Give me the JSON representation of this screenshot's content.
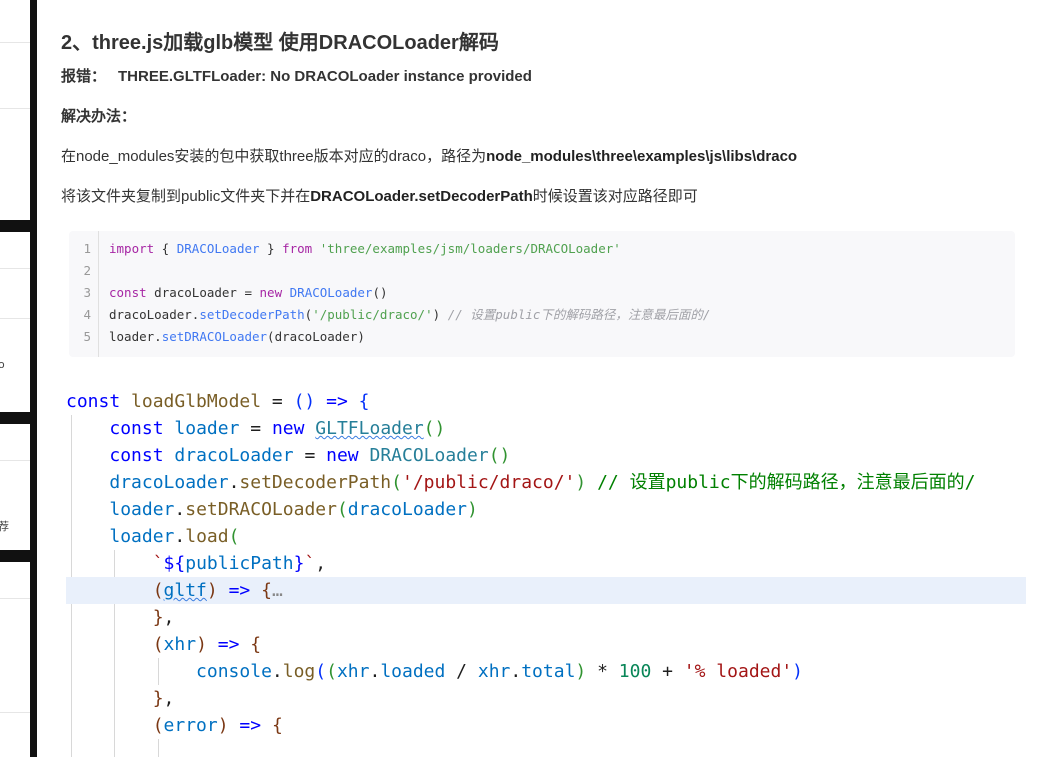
{
  "sidebar": {
    "fragments": [
      "o",
      "荐"
    ]
  },
  "article": {
    "title": "2、three.js加载glb模型  使用DRACOLoader解码",
    "error_label": "报错：",
    "error_message": "THREE.GLTFLoader: No DRACOLoader instance provided",
    "solution_heading": "解决办法：",
    "para1_prefix": "在node_modules安装的包中获取three版本对应的draco，路径为",
    "para1_path": "node_modules\\three\\examples\\js\\libs\\draco",
    "para2_prefix": "将该文件夹复制到public文件夹下并在",
    "para2_method": "DRACOLoader.setDecoderPath",
    "para2_suffix": "时候设置该对应路径即可"
  },
  "code_block": {
    "line_numbers": [
      "1",
      "2",
      "3",
      "4",
      "5"
    ],
    "lines": [
      "import { DRACOLoader } from 'three/examples/jsm/loaders/DRACOLoader'",
      "",
      "const dracoLoader = new DRACOLoader()",
      "dracoLoader.setDecoderPath('/public/draco/') // 设置public下的解码路径，注意最后面的/",
      "loader.setDRACOLoader(dracoLoader)"
    ]
  },
  "screenshot_code": {
    "lines": [
      "const loadGlbModel = () => {",
      "    const loader = new GLTFLoader()",
      "    const dracoLoader = new DRACOLoader()",
      "    dracoLoader.setDecoderPath('/public/draco/') // 设置public下的解码路径，注意最后面的/",
      "    loader.setDRACOLoader(dracoLoader)",
      "    loader.load(",
      "        `${publicPath}`,",
      "        (gltf) => {…",
      "        },",
      "        (xhr) => {",
      "            console.log((xhr.loaded / xhr.total) * 100 + '% loaded')",
      "        },",
      "        (error) => {"
    ],
    "highlight_line": 8,
    "colors": {
      "keyword": "#0000ff",
      "variable": "#0070c1",
      "function": "#795e26",
      "class": "#267f99",
      "string": "#a31515",
      "comment": "#008000",
      "highlight": "#e9f0fb"
    }
  }
}
